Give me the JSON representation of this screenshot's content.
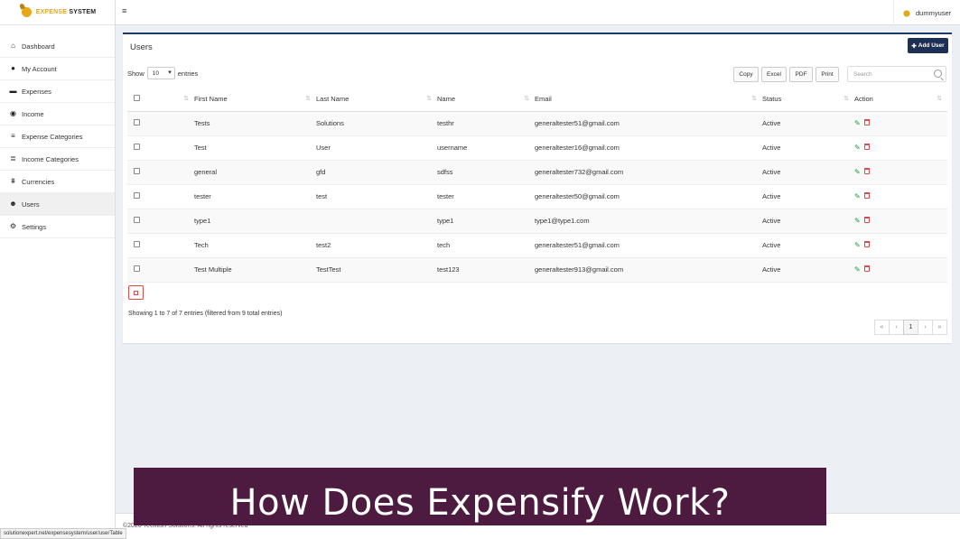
{
  "brand": {
    "part1": "EXPENSE",
    "part2": "SYSTEM"
  },
  "sidebar": {
    "items": [
      {
        "label": "Dashboard",
        "icon": "home-icon"
      },
      {
        "label": "My Account",
        "icon": "user-icon"
      },
      {
        "label": "Expenses",
        "icon": "credit-card-icon"
      },
      {
        "label": "Income",
        "icon": "coin-icon"
      },
      {
        "label": "Expense Categories",
        "icon": "list-icon"
      },
      {
        "label": "Income Categories",
        "icon": "list-alt-icon"
      },
      {
        "label": "Currencies",
        "icon": "bank-icon"
      },
      {
        "label": "Users",
        "icon": "users-icon"
      },
      {
        "label": "Settings",
        "icon": "gears-icon"
      }
    ],
    "active_index": 7
  },
  "header": {
    "username": "dummyuser"
  },
  "card": {
    "title": "Users",
    "add_button": "Add User",
    "show_label": "Show",
    "entries_label": "entries",
    "page_size": "10",
    "export_buttons": [
      "Copy",
      "Excel",
      "PDF",
      "Print"
    ],
    "search_placeholder": "Search"
  },
  "table": {
    "columns": [
      "First Name",
      "Last Name",
      "Name",
      "Email",
      "Status",
      "Action"
    ],
    "rows": [
      [
        "Tests",
        "Solutions",
        "testhr",
        "generaltester51@gmail.com",
        "Active"
      ],
      [
        "Test",
        "User",
        "username",
        "generaltester16@gmail.com",
        "Active"
      ],
      [
        "general",
        "gfd",
        "sdfss",
        "generaltester732@gmail.com",
        "Active"
      ],
      [
        "tester",
        "test",
        "tester",
        "generaltester50@gmail.com",
        "Active"
      ],
      [
        "type1",
        "",
        "type1",
        "type1@type1.com",
        "Active"
      ],
      [
        "Tech",
        "test2",
        "tech",
        "generaltester51@gmail.com",
        "Active"
      ],
      [
        "Test Multiple",
        "TestTest",
        "test123",
        "generaltester913@gmail.com",
        "Active"
      ]
    ]
  },
  "info": "Showing 1 to 7 of 7 entries (filtered from 9 total entries)",
  "pagination": {
    "first": "«",
    "prev": "‹",
    "current": "1",
    "next": "›",
    "last": "»"
  },
  "footer": "©2020 Techtish Solutions. All rights reserved",
  "status_url": "solutionexpert.net/expensesystem/user/userTable",
  "banner": "How Does Expensify Work?",
  "colors": {
    "primary": "#1e2f56",
    "danger": "#e0494a",
    "success": "#1a9a2e",
    "banner": "#4c1b3f",
    "accent": "#e6a817"
  }
}
